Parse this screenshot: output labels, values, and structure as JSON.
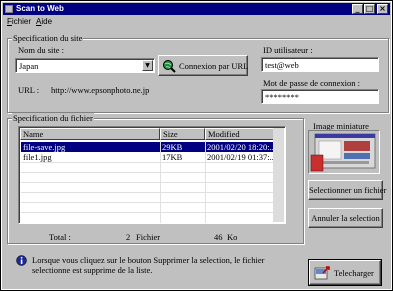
{
  "window": {
    "title": "Scan to Web"
  },
  "menu": {
    "file": "Fichier",
    "help": "Aide"
  },
  "site": {
    "group_label": "Specification du site",
    "name_label": "Nom du site :",
    "name_value": "Japan",
    "connect_button": "Connexion par URL",
    "url_label": "URL :",
    "url_value": "http://www.epsonphoto.ne.jp",
    "user_id_label": "ID utilisateur :",
    "user_id_value": "test@web",
    "password_label": "Mot de passe de connexion :",
    "password_value": "********"
  },
  "files": {
    "group_label": "Specification du fichier",
    "columns": [
      "Name",
      "Size",
      "Modified"
    ],
    "rows": [
      {
        "name": "file-save.jpg",
        "size": "29KB",
        "modified": "2001/02/20 18:20:..."
      },
      {
        "name": "file1.jpg",
        "size": "17KB",
        "modified": "2001/02/19 01:37:..."
      }
    ],
    "total_label": "Total :",
    "total_count": "2",
    "total_count_unit": "Fichier",
    "total_size": "46",
    "total_size_unit": "Ko"
  },
  "thumbnail": {
    "label": "Image miniature"
  },
  "buttons": {
    "select_file": "Selectionner un fichier",
    "cancel_selection": "Annuler la selection",
    "upload": "Telecharger"
  },
  "info": {
    "message": "Lorsque vous cliquez sur le bouton Supprimer la selection, le fichier selectionne est supprime de la liste."
  },
  "colors": {
    "titlebar": "#000080",
    "face": "#c0c0c0",
    "selection": "#000080"
  }
}
